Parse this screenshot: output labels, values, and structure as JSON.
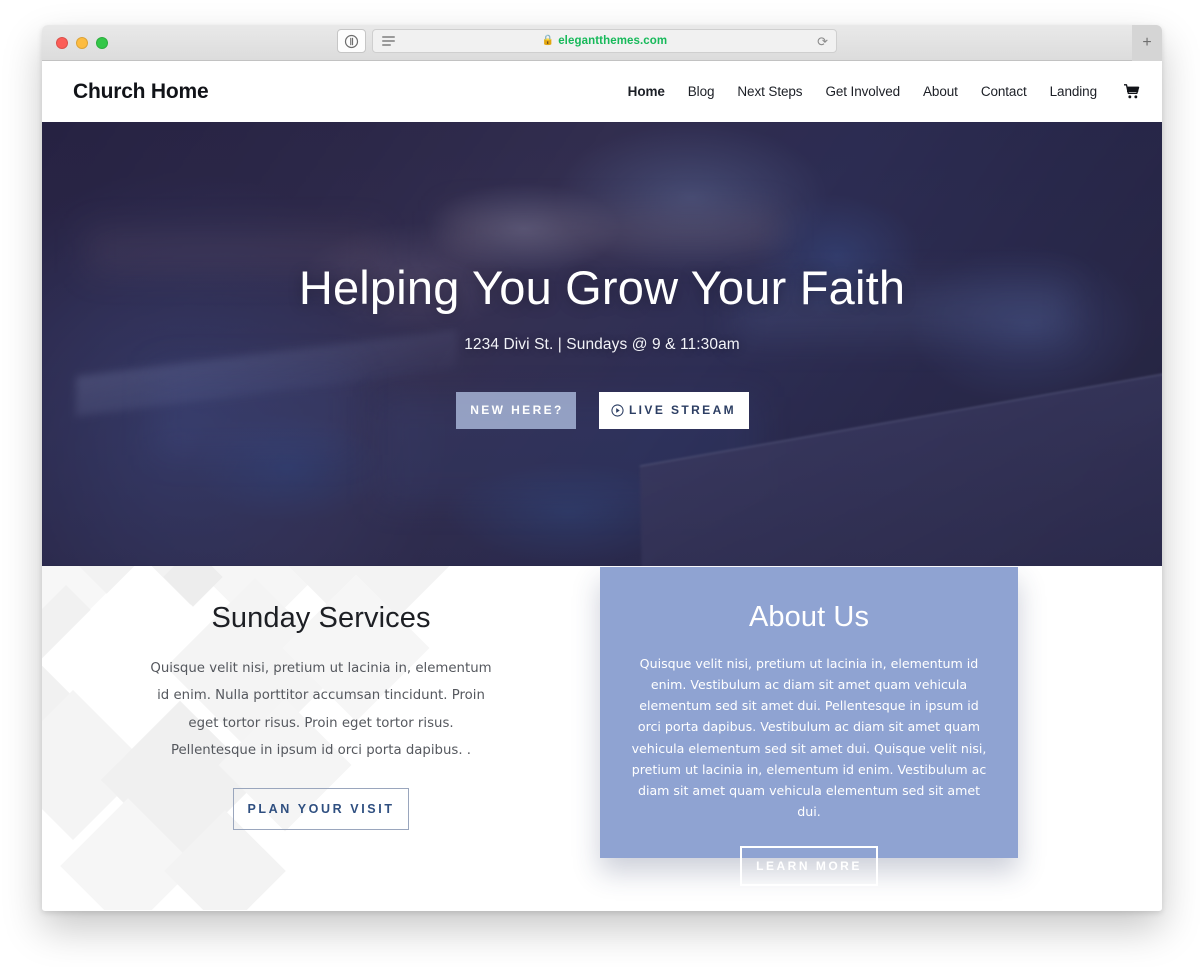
{
  "browser": {
    "traffic_lights": [
      "close",
      "minimize",
      "zoom"
    ],
    "sidebar_toggle_icon": "sidebar-toggle-icon",
    "reader_icon": "reader-view-icon",
    "lock_icon": "lock-icon",
    "url": "elegantthemes.com",
    "reload_icon": "reload-icon",
    "new_tab_label": "+",
    "accent_secure": "#17b95a"
  },
  "site": {
    "logo": "Church Home",
    "nav": [
      {
        "label": "Home",
        "active": true
      },
      {
        "label": "Blog",
        "active": false
      },
      {
        "label": "Next Steps",
        "active": false
      },
      {
        "label": "Get Involved",
        "active": false
      },
      {
        "label": "About",
        "active": false
      },
      {
        "label": "Contact",
        "active": false
      },
      {
        "label": "Landing",
        "active": false
      }
    ],
    "cart_icon": "shopping-cart-icon"
  },
  "hero": {
    "title": "Helping You Grow Your Faith",
    "subtitle": "1234 Divi St. | Sundays @ 9 & 11:30am",
    "primary_button": "NEW HERE?",
    "secondary_button": "LIVE STREAM",
    "secondary_button_icon": "play-circle-icon"
  },
  "services": {
    "title": "Sunday Services",
    "body": "Quisque velit nisi, pretium ut lacinia in, elementum id enim. Nulla porttitor accumsan tincidunt. Proin eget tortor risus. Proin eget tortor risus. Pellentesque in ipsum id orci porta dapibus. .",
    "button": "PLAN YOUR VISIT"
  },
  "about": {
    "title": "About Us",
    "body": "Quisque velit nisi, pretium ut lacinia in, elementum id enim. Vestibulum ac diam sit amet quam vehicula elementum sed sit amet dui. Pellentesque in ipsum id orci porta dapibus. Vestibulum ac diam sit amet quam vehicula elementum sed sit amet dui. Quisque velit nisi, pretium ut lacinia in, elementum id enim. Vestibulum ac diam sit amet quam vehicula elementum sed sit amet dui.",
    "button": "LEARN MORE",
    "background_color": "#8fa3d2"
  }
}
